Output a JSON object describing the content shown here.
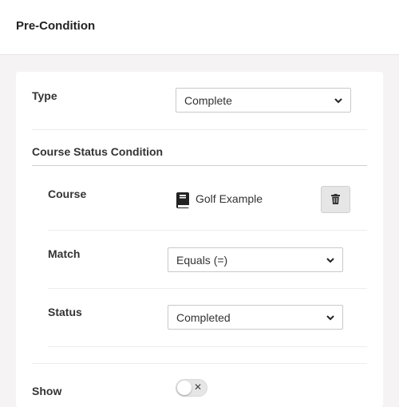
{
  "header": {
    "title": "Pre-Condition"
  },
  "type_field": {
    "label": "Type",
    "value": "Complete"
  },
  "course_status": {
    "title": "Course Status Condition",
    "course": {
      "label": "Course",
      "name": "Golf Example"
    },
    "match": {
      "label": "Match",
      "value": "Equals (=)"
    },
    "status": {
      "label": "Status",
      "value": "Completed"
    }
  },
  "show": {
    "label": "Show",
    "toggle_on": false,
    "toggle_off_symbol": "✕"
  },
  "icons": {
    "course": "book-icon",
    "delete": "trash-icon",
    "dropdown": "chevron-down-icon"
  }
}
